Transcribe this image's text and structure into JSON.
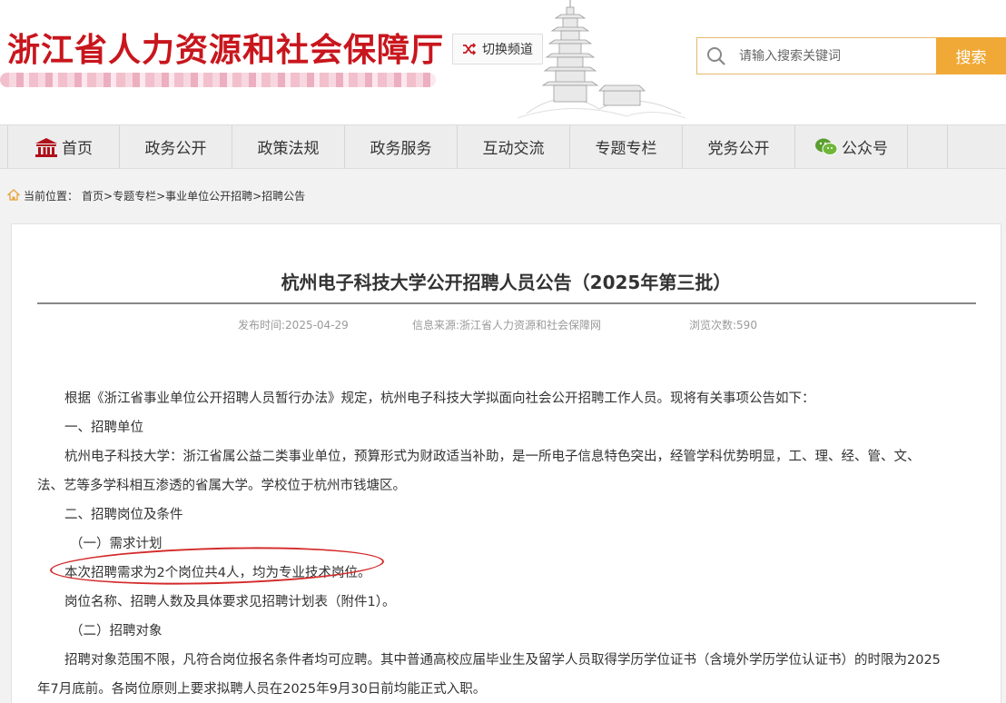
{
  "header": {
    "site_title": "浙江省人力资源和社会保障厅",
    "switch_label": "切换频道",
    "search_placeholder": "请输入搜索关键词",
    "search_button": "搜索"
  },
  "nav": {
    "items": [
      {
        "label": "首页",
        "icon": "home-icon"
      },
      {
        "label": "政务公开"
      },
      {
        "label": "政策法规"
      },
      {
        "label": "政务服务"
      },
      {
        "label": "互动交流"
      },
      {
        "label": "专题专栏"
      },
      {
        "label": "党务公开"
      },
      {
        "label": "公众号",
        "icon": "wechat-icon"
      }
    ]
  },
  "breadcrumb": {
    "prefix": "当前位置：",
    "path": "首页>专题专栏>事业单位公开招聘>招聘公告"
  },
  "article": {
    "title": "杭州电子科技大学公开招聘人员公告（2025年第三批）",
    "meta": {
      "date": "发布时间:2025-04-29",
      "source": "信息来源:浙江省人力资源和社会保障网",
      "views": "浏览次数:590"
    },
    "paragraphs": [
      "根据《浙江省事业单位公开招聘人员暂行办法》规定，杭州电子科技大学拟面向社会公开招聘工作人员。现将有关事项公告如下：",
      "一、招聘单位",
      "杭州电子科技大学：浙江省属公益二类事业单位，预算形式为财政适当补助，是一所电子信息特色突出，经管学科优势明显，工、理、经、管、文、",
      "法、艺等多学科相互渗透的省属大学。学校位于杭州市钱塘区。",
      "二、招聘岗位及条件",
      "（一）需求计划",
      "本次招聘需求为2个岗位共4人，均为专业技术岗位。",
      "岗位名称、招聘人数及具体要求见招聘计划表（附件1）。",
      "（二）招聘对象",
      "招聘对象范围不限，凡符合岗位报名条件者均可应聘。其中普通高校应届毕业生及留学人员取得学历学位证书（含境外学历学位认证书）的时限为2025",
      "年7月底前。各岗位原则上要求拟聘人员在2025年9月30日前均能正式入职。"
    ]
  },
  "colors": {
    "brand_red": "#c8161d",
    "search_orange": "#f0a937",
    "highlight_ellipse": "#d42a2a"
  }
}
